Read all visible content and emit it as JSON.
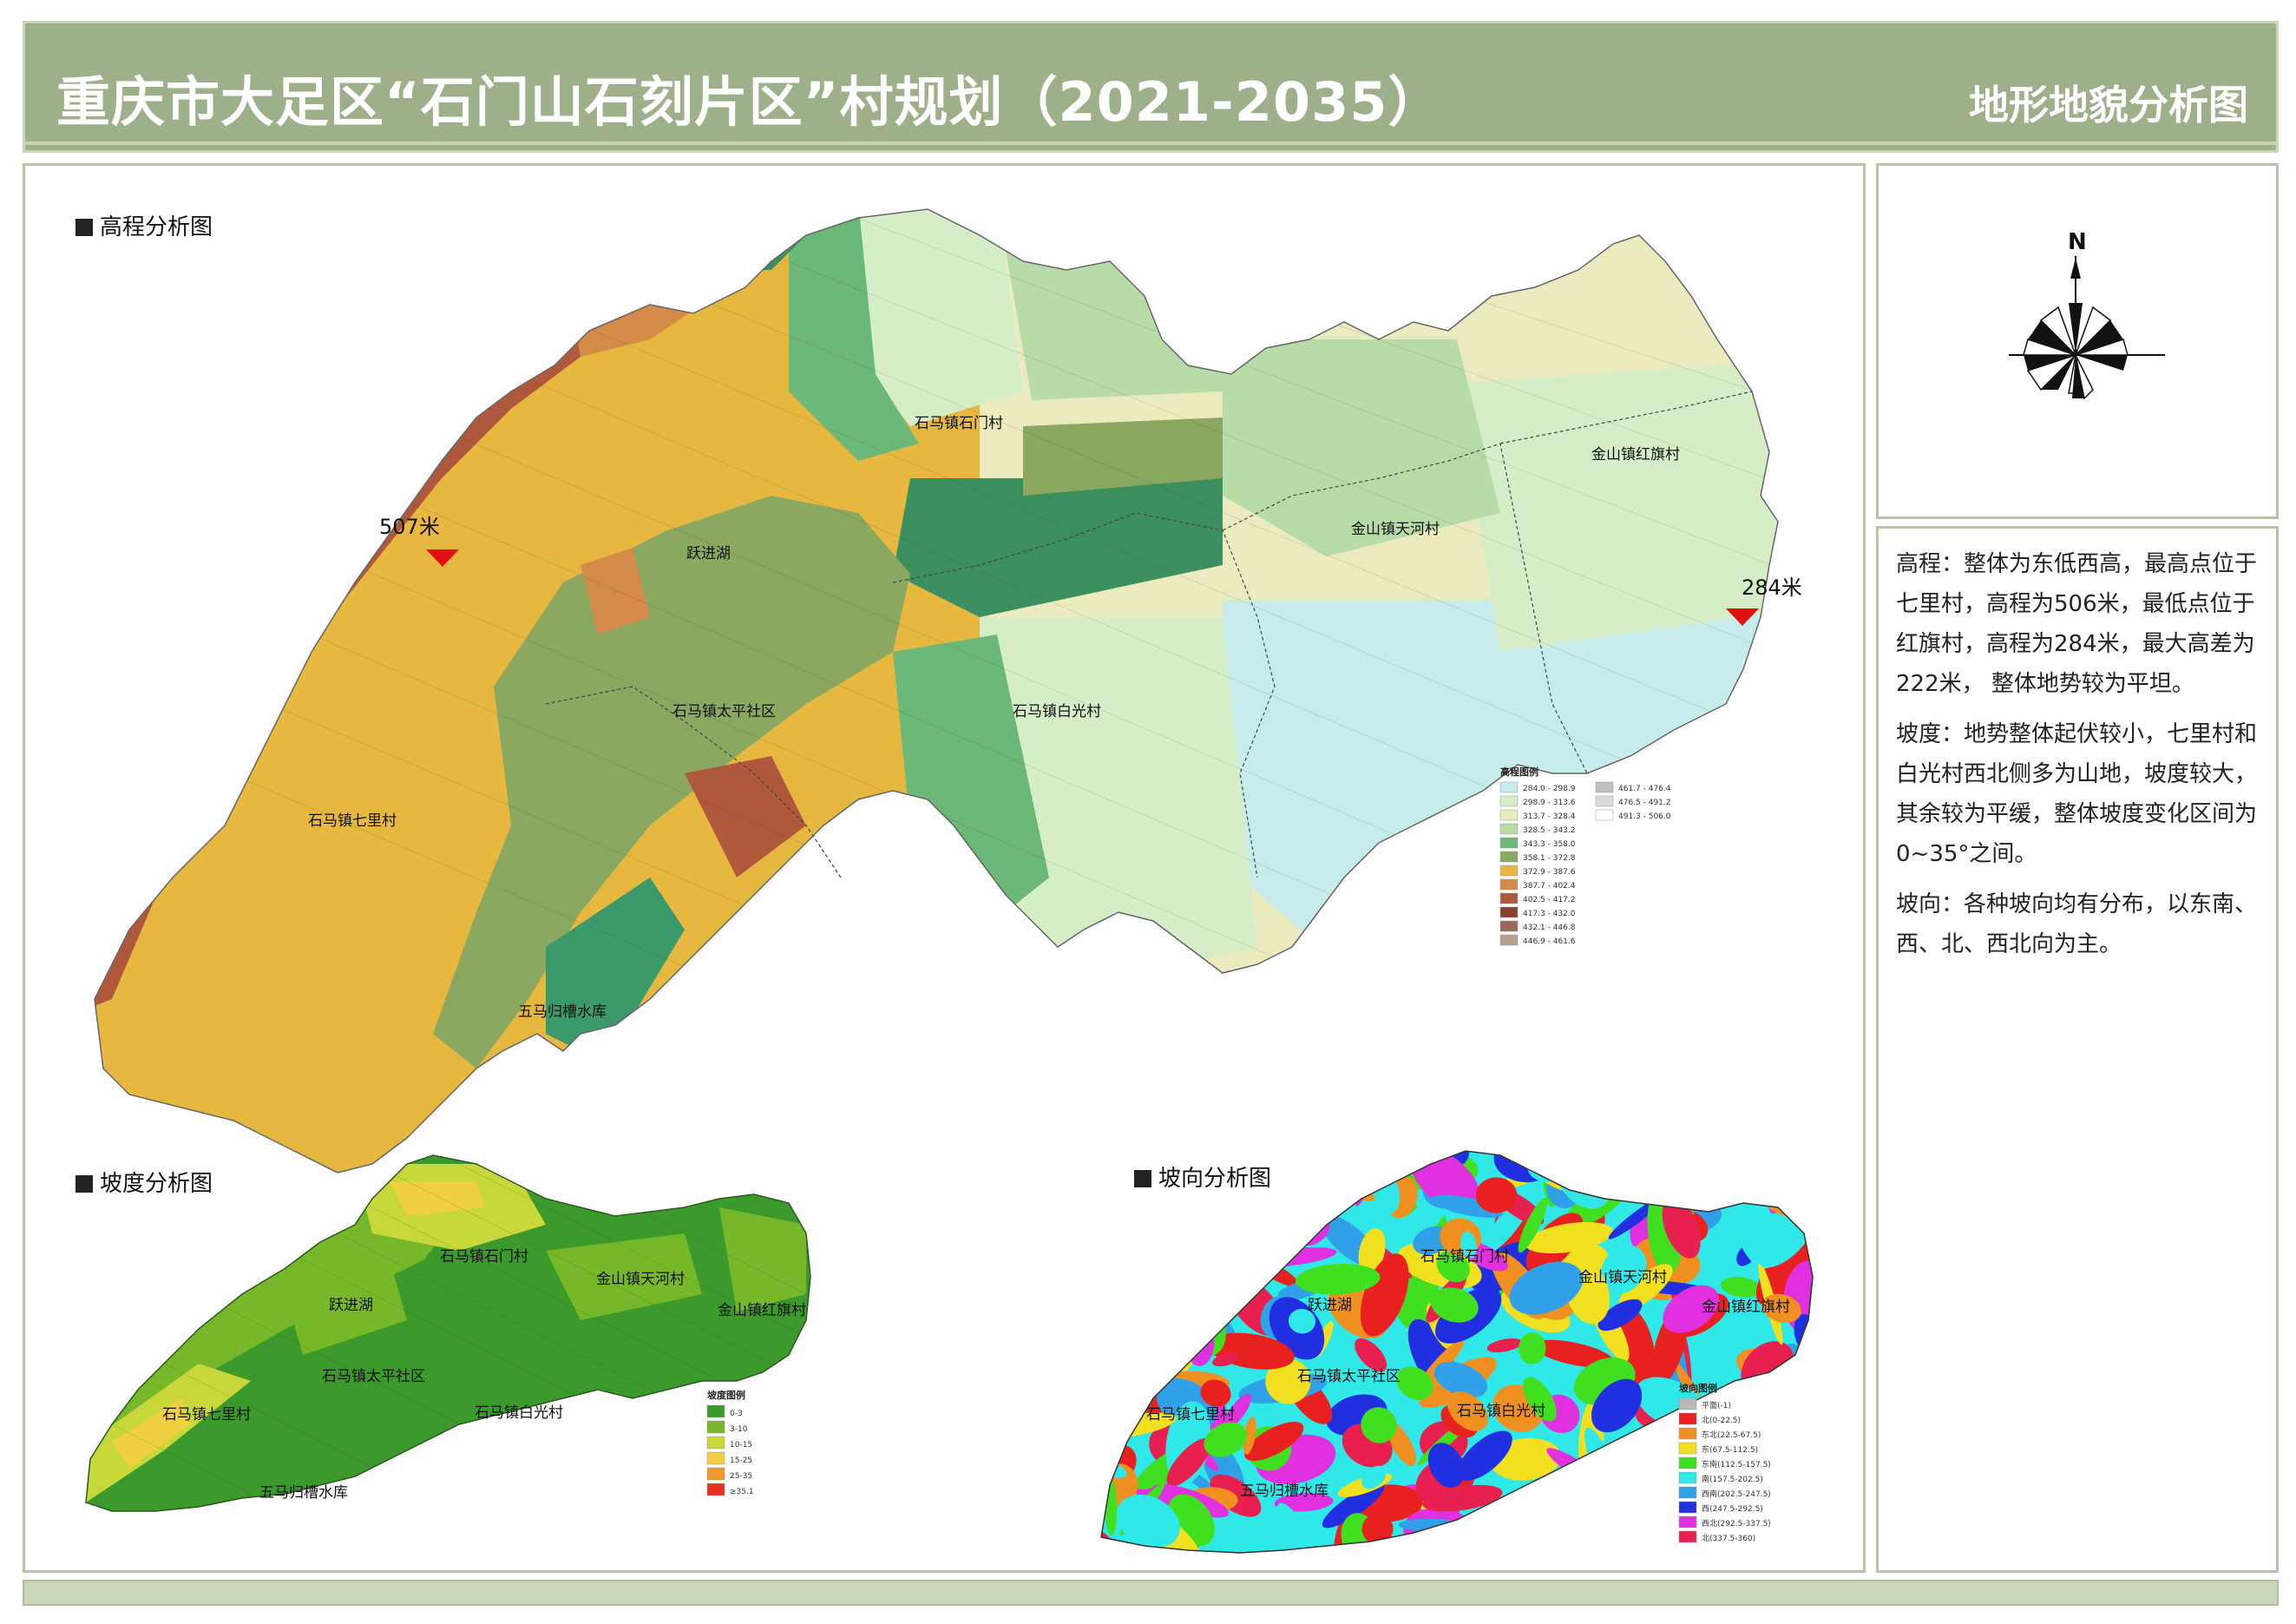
{
  "header": {
    "plan_title": "重庆市大足区“石门山石刻片区”村规划（2021-2035）",
    "map_type": "地形地貌分析图"
  },
  "sections": {
    "elevation": "高程分析图",
    "slope": "坡度分析图",
    "aspect": "坡向分析图"
  },
  "elevation_markers": {
    "max": "507米",
    "min": "284米"
  },
  "villages_main": {
    "shimen": "石马镇石门村",
    "yuejin": "跃进湖",
    "hongqi": "金山镇红旗村",
    "tianhe": "金山镇天河村",
    "taiping": "石马镇太平社区",
    "baiguang": "石马镇白光村",
    "qili": "石马镇七里村",
    "reservoir": "五马归槽水库"
  },
  "villages_slope": {
    "shimen": "石马镇石门村",
    "tianhe": "金山镇天河村",
    "yuejin": "跃进湖",
    "hongqi": "金山镇红旗村",
    "taiping": "石马镇太平社区",
    "qili": "石马镇七里村",
    "baiguang": "石马镇白光村",
    "reservoir": "五马归槽水库"
  },
  "villages_aspect": {
    "shimen": "石马镇石门村",
    "tianhe": "金山镇天河村",
    "yuejin": "跃进湖",
    "hongqi": "金山镇红旗村",
    "taiping": "石马镇太平社区",
    "qili": "石马镇七里村",
    "baiguang": "石马镇白光村",
    "reservoir": "五马归槽水库"
  },
  "elevation_legend": {
    "title": "高程图例",
    "col1": [
      {
        "label": "284.0 - 298.9",
        "color": "#c8ecec"
      },
      {
        "label": "298.9 - 313.6",
        "color": "#d6eec8"
      },
      {
        "label": "313.7 - 328.4",
        "color": "#ecebc0"
      },
      {
        "label": "328.5 - 343.2",
        "color": "#b8dca8"
      },
      {
        "label": "343.3 - 358.0",
        "color": "#6cb878"
      },
      {
        "label": "358.1 - 372.8",
        "color": "#8aa860"
      },
      {
        "label": "372.9 - 387.6",
        "color": "#e6b840"
      },
      {
        "label": "387.7 - 402.4",
        "color": "#d48a48"
      },
      {
        "label": "402.5 - 417.2",
        "color": "#b0583c"
      },
      {
        "label": "417.3 - 432.0",
        "color": "#8a4030"
      },
      {
        "label": "432.1 - 446.8",
        "color": "#9a6a58"
      },
      {
        "label": "446.9 - 461.6",
        "color": "#b8a090"
      }
    ],
    "col2": [
      {
        "label": "461.7 - 476.4",
        "color": "#c0c0c0"
      },
      {
        "label": "476.5 - 491.2",
        "color": "#dcdcdc"
      },
      {
        "label": "491.3 - 506.0",
        "color": "#ffffff"
      }
    ]
  },
  "slope_legend": {
    "title": "坡度图例",
    "items": [
      {
        "label": "0-3",
        "color": "#3c9a2c"
      },
      {
        "label": "3-10",
        "color": "#76b82a"
      },
      {
        "label": "10-15",
        "color": "#c8d83a"
      },
      {
        "label": "15-25",
        "color": "#f0d040"
      },
      {
        "label": "25-35",
        "color": "#f09a30"
      },
      {
        "label": "≥35.1",
        "color": "#e83020"
      }
    ]
  },
  "aspect_legend": {
    "title": "坡向图例",
    "items": [
      {
        "label": "平面(-1)",
        "color": "#b8b8b8"
      },
      {
        "label": "北(0-22.5)",
        "color": "#e82020"
      },
      {
        "label": "东北(22.5-67.5)",
        "color": "#f09020"
      },
      {
        "label": "东(67.5-112.5)",
        "color": "#f0e020"
      },
      {
        "label": "东南(112.5-157.5)",
        "color": "#40e020"
      },
      {
        "label": "南(157.5-202.5)",
        "color": "#30e8e8"
      },
      {
        "label": "西南(202.5-247.5)",
        "color": "#30a0e8"
      },
      {
        "label": "西(247.5-292.5)",
        "color": "#2030e0"
      },
      {
        "label": "西北(292.5-337.5)",
        "color": "#e030e0"
      },
      {
        "label": "北(337.5-360)",
        "color": "#e82050"
      }
    ]
  },
  "analysis": {
    "elevation": "高程：整体为东低西高，最高点位于七里村，高程为506米，最低点位于红旗村，高程为284米，最大高差为222米， 整体地势较为平坦。",
    "slope": "坡度：地势整体起伏较小，七里村和白光村西北侧多为山地，坡度较大，其余较为平缓，整体坡度变化区间为0~35°之间。",
    "aspect": "坡向：各种坡向均有分布，以东南、西、北、西北向为主。"
  },
  "compass": {
    "north": "N"
  }
}
